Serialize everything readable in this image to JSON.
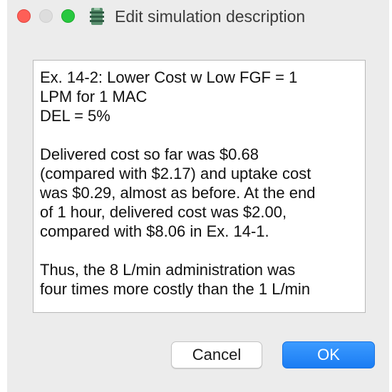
{
  "window": {
    "title": "Edit simulation description",
    "app_icon": "app-icon"
  },
  "traffic_lights": {
    "close_color": "#fe5f57",
    "minimize_color": "#dddddd",
    "maximize_color": "#28c840"
  },
  "description": {
    "text": "Ex. 14-2: Lower Cost w Low FGF = 1\nLPM for 1 MAC\nDEL = 5%\n\nDelivered cost so far was $0.68\n(compared with $2.17) and uptake cost\nwas $0.29, almost as before. At the end\nof 1 hour, delivered cost was $2.00,\ncompared with $8.06 in Ex. 14-1.\n\nThus, the 8 L/min administration was\nfour times more costly than the 1 L/min"
  },
  "buttons": {
    "cancel_label": "Cancel",
    "ok_label": "OK",
    "ok_color": "#1a7cf3"
  }
}
